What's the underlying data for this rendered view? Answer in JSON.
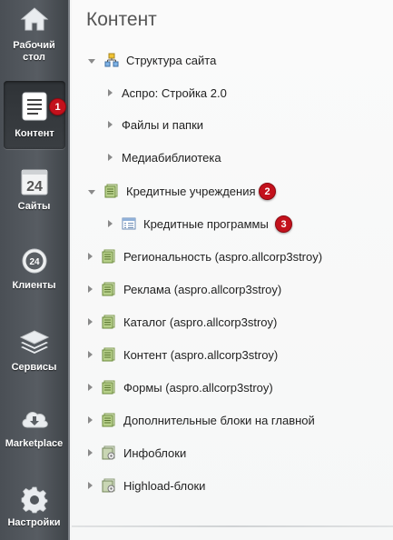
{
  "sidebar": {
    "items": [
      {
        "label_line1": "Рабочий",
        "label_line2": "стол",
        "icon": "home-icon"
      },
      {
        "label": "Контент",
        "icon": "document-icon",
        "active": true
      },
      {
        "label": "Сайты",
        "icon": "calendar-24-icon",
        "calendar_day": "24"
      },
      {
        "label": "Клиенты",
        "icon": "clock-24-icon",
        "clock_text": "24"
      },
      {
        "label": "Сервисы",
        "icon": "layers-icon"
      },
      {
        "label": "Marketplace",
        "icon": "cloud-download-icon"
      },
      {
        "label": "Настройки",
        "icon": "gear-icon"
      }
    ]
  },
  "main": {
    "title": "Контент",
    "tree": [
      {
        "label": "Структура сайта",
        "expanded": true,
        "icon": "sitemap-icon"
      },
      {
        "label": "Аспро: Стройка 2.0",
        "icon": "none"
      },
      {
        "label": "Файлы и папки",
        "icon": "none"
      },
      {
        "label": "Медиабиблиотека",
        "icon": "none"
      },
      {
        "label": "Кредитные учреждения",
        "expanded": true,
        "icon": "iblock-type-icon"
      },
      {
        "label": "Кредитные программы",
        "icon": "iblock-list-icon"
      },
      {
        "label": "Региональность (aspro.allcorp3stroy)",
        "icon": "iblock-type-icon"
      },
      {
        "label": "Реклама (aspro.allcorp3stroy)",
        "icon": "iblock-type-icon"
      },
      {
        "label": "Каталог (aspro.allcorp3stroy)",
        "icon": "iblock-type-icon"
      },
      {
        "label": "Контент (aspro.allcorp3stroy)",
        "icon": "iblock-type-icon"
      },
      {
        "label": "Формы (aspro.allcorp3stroy)",
        "icon": "iblock-type-icon"
      },
      {
        "label": "Дополнительные блоки на главной",
        "icon": "iblock-type-icon"
      },
      {
        "label": "Инфоблоки",
        "icon": "iblock-settings-icon"
      },
      {
        "label": "Highload-блоки",
        "icon": "iblock-settings-icon"
      }
    ]
  },
  "badges": {
    "one": "1",
    "two": "2",
    "three": "3"
  },
  "colors": {
    "badge": "#c3111c",
    "sidebar": "#4f545a",
    "main_bg": "#f6f7f7"
  }
}
